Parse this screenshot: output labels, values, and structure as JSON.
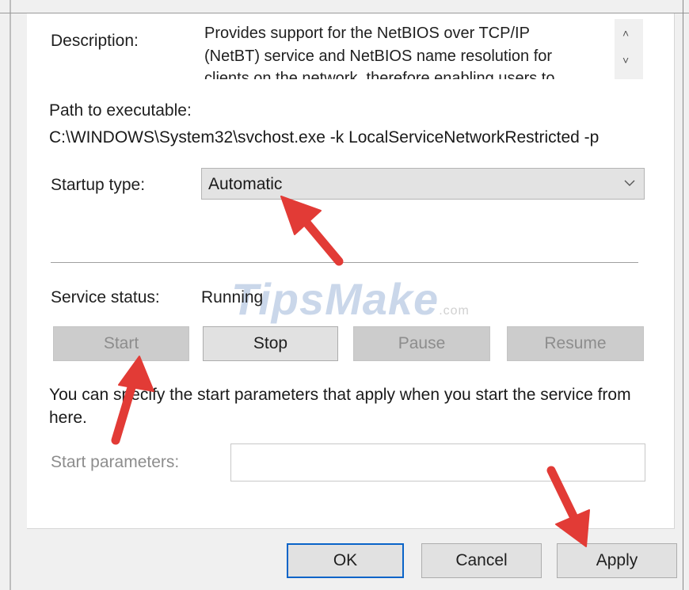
{
  "description": {
    "label": "Description:",
    "lines": [
      "Provides support for the NetBIOS over TCP/IP",
      "(NetBT) service and NetBIOS name resolution for",
      "clients on the network, therefore enabling users to"
    ]
  },
  "path": {
    "label": "Path to executable:",
    "value": "C:\\WINDOWS\\System32\\svchost.exe -k LocalServiceNetworkRestricted -p"
  },
  "startup": {
    "label": "Startup type:",
    "value": "Automatic"
  },
  "service_status": {
    "label": "Service status:",
    "value": "Running"
  },
  "buttons": {
    "start": "Start",
    "stop": "Stop",
    "pause": "Pause",
    "resume": "Resume"
  },
  "hint": "You can specify the start parameters that apply when you start the service from here.",
  "start_params": {
    "label": "Start parameters:",
    "value": ""
  },
  "dialog": {
    "ok": "OK",
    "cancel": "Cancel",
    "apply": "Apply"
  },
  "watermark": {
    "brand": "TipsMake",
    "suffix": ".com"
  },
  "colors": {
    "annotation_arrow": "#e23b36",
    "default_button_border": "#0a64c8"
  }
}
